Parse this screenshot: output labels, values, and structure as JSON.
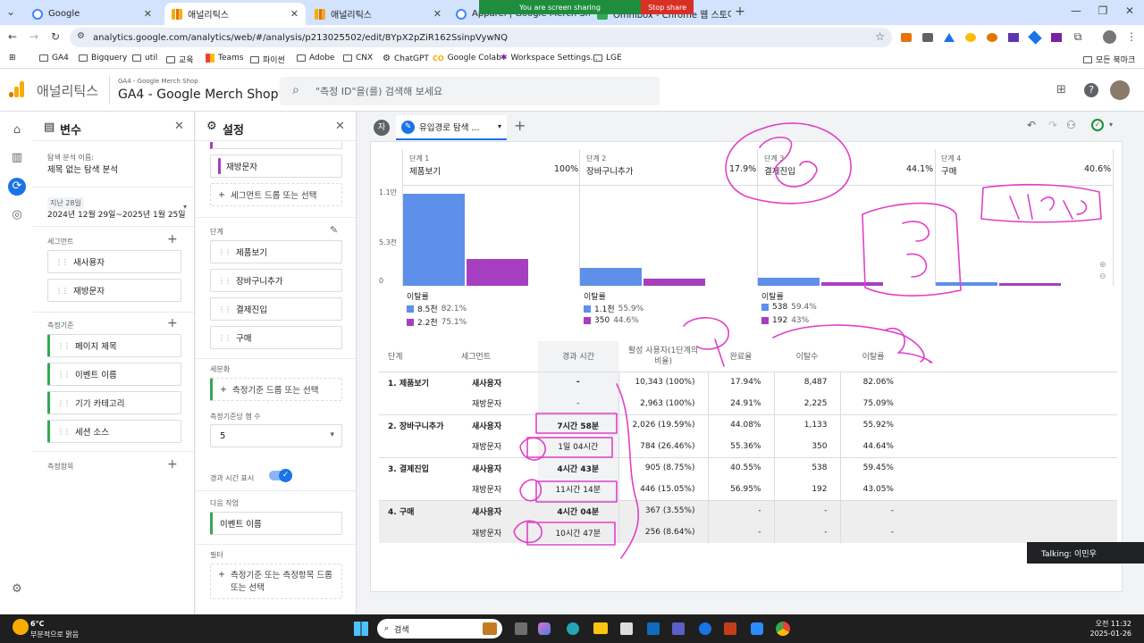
{
  "browser": {
    "tabs": [
      {
        "title": "Google",
        "active": false
      },
      {
        "title": "애널리틱스",
        "active": true
      },
      {
        "title": "애널리틱스",
        "active": false
      },
      {
        "title": "Apparel | Google Merch Shop",
        "active": false
      },
      {
        "title": "Omnibox - Chrome 웹 스토어",
        "active": false
      }
    ],
    "share_banner": "You are screen sharing",
    "stop_share": "Stop share",
    "url": "analytics.google.com/analytics/web/#/analysis/p213025502/edit/8YpX2pZiR162SsinpVywNQ",
    "bookmarks": [
      "GA4",
      "Bigquery",
      "util",
      "교육",
      "Teams",
      "파이썬",
      "Adobe",
      "CNX",
      "ChatGPT",
      "Google Colab",
      "Workspace Settings...",
      "LGE"
    ],
    "all_bookmarks": "모든 북마크"
  },
  "ga": {
    "product": "애널리틱스",
    "account_small": "GA4 - Google Merch Shop",
    "property": "GA4 - Google Merch Shop",
    "search_placeholder": "\"측정 ID\"을(를) 검색해 보세요"
  },
  "variables": {
    "title": "변수",
    "analysis_name_label": "탐색 분석 이름:",
    "analysis_name": "제목 없는 탐색 분석",
    "date_label": "지난 28일",
    "date_range": "2024년 12월 29일~2025년 1월 25일",
    "segments_label": "세그먼트",
    "segments": [
      "새사용자",
      "재방문자"
    ],
    "dimensions_label": "측정기준",
    "dimensions": [
      "페이지 제목",
      "이벤트 이름",
      "기기 카테고리",
      "세션 소스"
    ],
    "metrics_label": "측정항목"
  },
  "settings": {
    "title": "설정",
    "segment_visible": "재방문자",
    "segment_drop": "세그먼트 드롭 또는 선택",
    "steps_label": "단계",
    "steps": [
      "제품보기",
      "장바구니추가",
      "결제진입",
      "구매"
    ],
    "breakdown_label": "세분화",
    "breakdown_drop": "측정기준 드롭 또는 선택",
    "rows_label": "측정기준당 행 수",
    "rows_value": "5",
    "elapsed_label": "경과 시간 표시",
    "next_action_label": "다음 작업",
    "next_action_value": "이벤트 이름",
    "filter_label": "필터",
    "filter_drop": "측정기준 또는 측정항목 드롭 또는 선택"
  },
  "canvas": {
    "tab_label": "유입경로 탐색 ...",
    "tab_badge": "자",
    "steps": [
      {
        "label": "단계 1",
        "name": "제품보기",
        "pct": "100%"
      },
      {
        "label": "단계 2",
        "name": "장바구니추가",
        "pct": "17.9%"
      },
      {
        "label": "단계 3",
        "name": "결제진입",
        "pct": "44.1%"
      },
      {
        "label": "단계 4",
        "name": "구매",
        "pct": "40.6%"
      }
    ],
    "y_ticks": [
      "1.1만",
      "5.3천",
      "0"
    ],
    "dropoff_label": "이탈률",
    "dropoffs": [
      {
        "new_val": "8.5천",
        "new_pct": "82.1%",
        "ret_val": "2.2천",
        "ret_pct": "75.1%"
      },
      {
        "new_val": "1.1천",
        "new_pct": "55.9%",
        "ret_val": "350",
        "ret_pct": "44.6%"
      },
      {
        "new_val": "538",
        "new_pct": "59.4%",
        "ret_val": "192",
        "ret_pct": "43%"
      }
    ]
  },
  "chart_data": {
    "type": "bar",
    "categories": [
      "제품보기",
      "장바구니추가",
      "결제진입",
      "구매"
    ],
    "series": [
      {
        "name": "새사용자",
        "values": [
          10343,
          2026,
          905,
          367
        ]
      },
      {
        "name": "재방문자",
        "values": [
          2963,
          784,
          446,
          256
        ]
      }
    ],
    "ylim": [
      0,
      11000
    ]
  },
  "table": {
    "headers": [
      "단계",
      "세그먼트",
      "경과 시간",
      "활성 사용자(1단계의 비율)",
      "완료율",
      "이탈수",
      "이탈률"
    ],
    "rows": [
      {
        "step": "1. 제품보기",
        "seg": "새사용자",
        "time": "-",
        "users": "10,343 (100%)",
        "rate": "17.94%",
        "drop": "8,487",
        "droprate": "82.06%"
      },
      {
        "step": "",
        "seg": "재방문자",
        "time": "-",
        "users": "2,963 (100%)",
        "rate": "24.91%",
        "drop": "2,225",
        "droprate": "75.09%"
      },
      {
        "step": "2. 장바구니추가",
        "seg": "새사용자",
        "time": "7시간 58분",
        "users": "2,026 (19.59%)",
        "rate": "44.08%",
        "drop": "1,133",
        "droprate": "55.92%"
      },
      {
        "step": "",
        "seg": "재방문자",
        "time": "1일 04시간",
        "users": "784 (26.46%)",
        "rate": "55.36%",
        "drop": "350",
        "droprate": "44.64%"
      },
      {
        "step": "3. 결제진입",
        "seg": "새사용자",
        "time": "4시간 43분",
        "users": "905 (8.75%)",
        "rate": "40.55%",
        "drop": "538",
        "droprate": "59.45%"
      },
      {
        "step": "",
        "seg": "재방문자",
        "time": "11시간 14분",
        "users": "446 (15.05%)",
        "rate": "56.95%",
        "drop": "192",
        "droprate": "43.05%"
      },
      {
        "step": "4. 구매",
        "seg": "새사용자",
        "time": "4시간 04분",
        "users": "367 (3.55%)",
        "rate": "-",
        "drop": "-",
        "droprate": "-"
      },
      {
        "step": "",
        "seg": "재방문자",
        "time": "10시간 47분",
        "users": "256 (8.64%)",
        "rate": "-",
        "drop": "-",
        "droprate": "-"
      }
    ]
  },
  "talking": "Talking: 이민우",
  "taskbar": {
    "weather_temp": "6°C",
    "weather_desc": "부분적으로 맑음",
    "search": "검색",
    "time": "오전 11:32",
    "date": "2025-01-26"
  },
  "colors": {
    "new_users": "#5e8fe9",
    "returning": "#a63fbf",
    "annotation": "#e040c8",
    "ga_orange": "#f9ab00"
  }
}
